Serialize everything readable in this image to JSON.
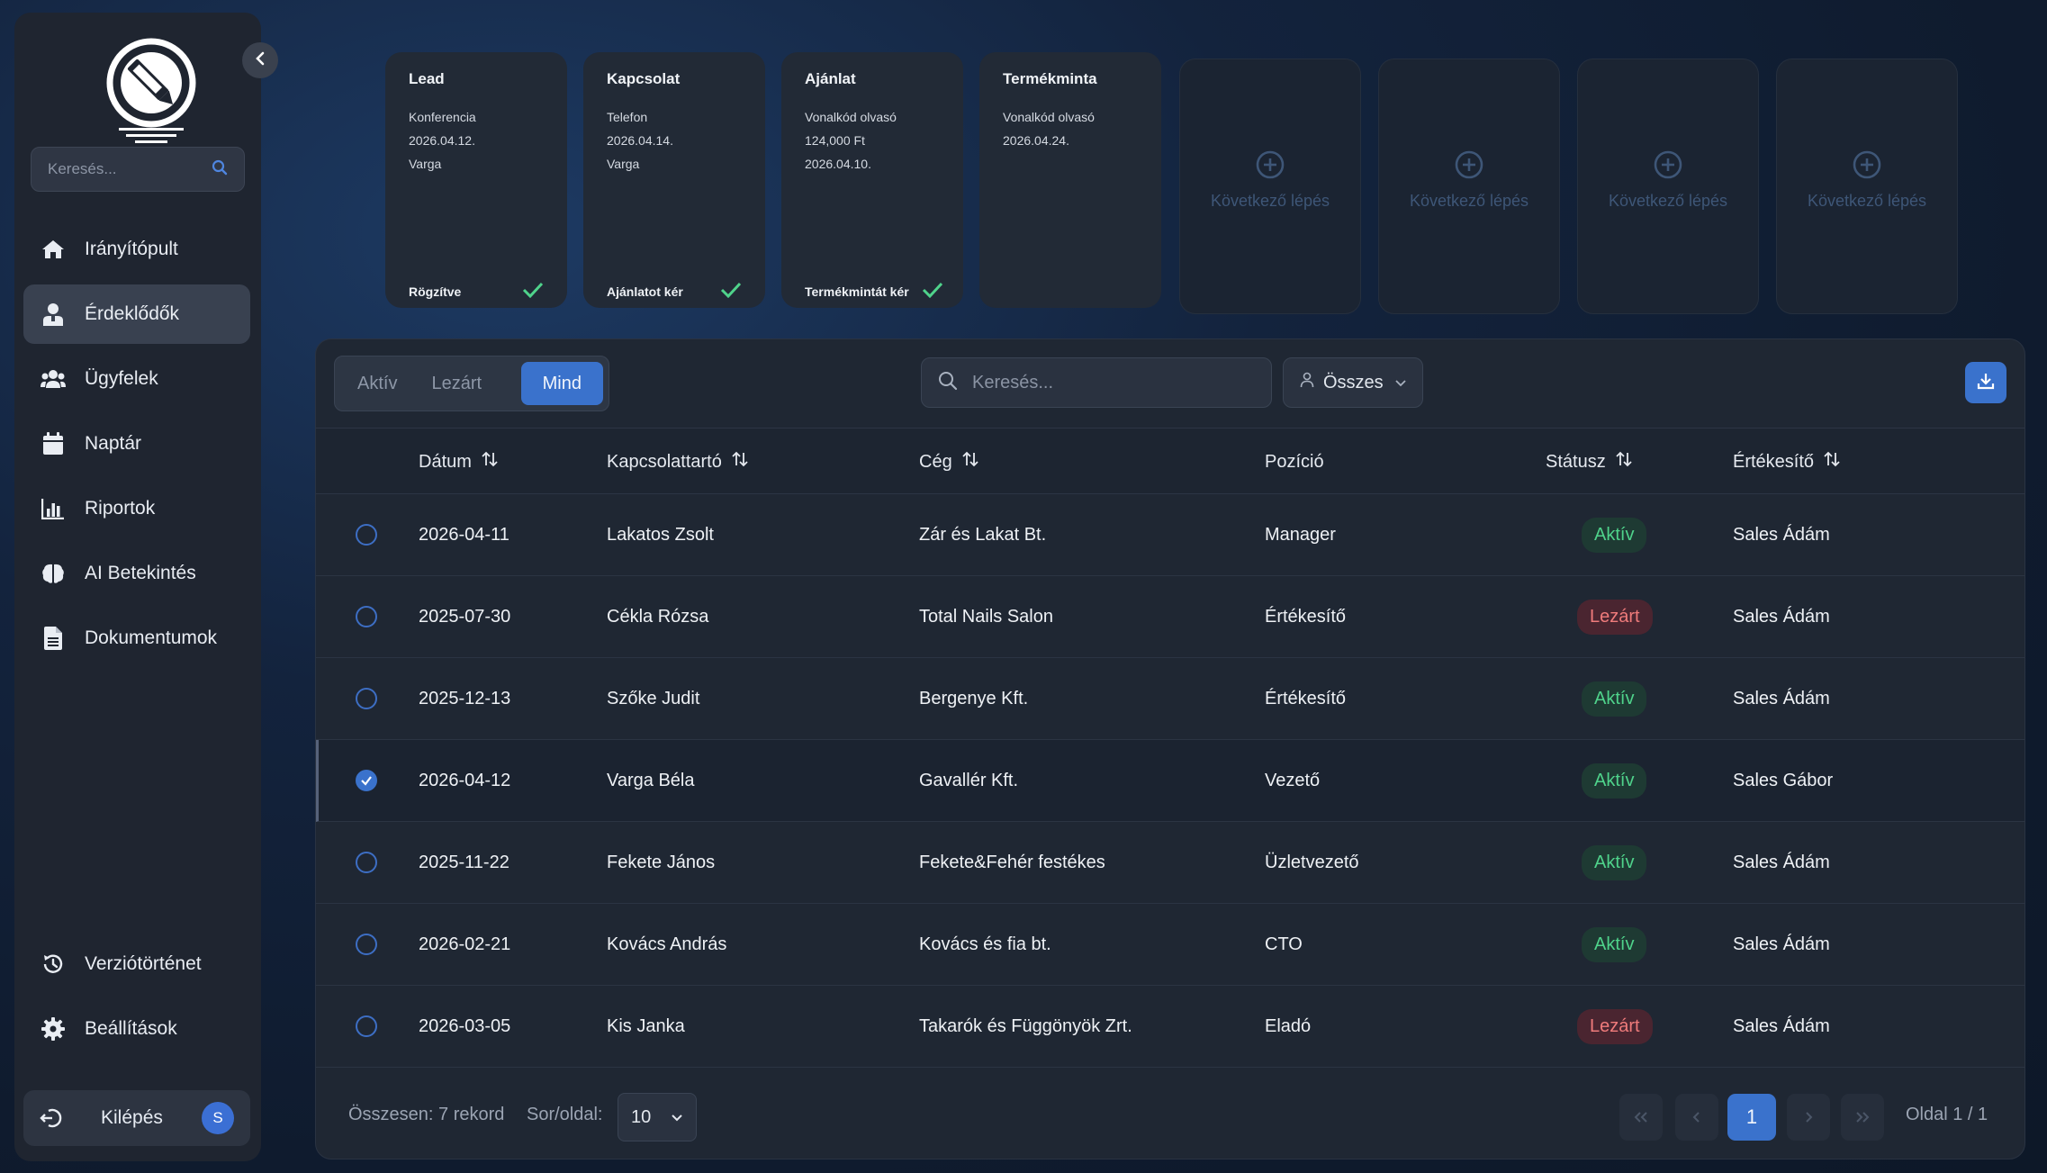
{
  "sidebar": {
    "search_placeholder": "Keresés...",
    "items": [
      {
        "label": "Irányítópult",
        "icon": "home-icon"
      },
      {
        "label": "Érdeklődők",
        "icon": "user-icon",
        "active": true
      },
      {
        "label": "Ügyfelek",
        "icon": "users-icon"
      },
      {
        "label": "Naptár",
        "icon": "calendar-icon"
      },
      {
        "label": "Riportok",
        "icon": "bar-chart-icon"
      },
      {
        "label": "AI Betekintés",
        "icon": "brain-icon"
      },
      {
        "label": "Dokumentumok",
        "icon": "document-icon"
      }
    ],
    "bottom_items": [
      {
        "label": "Verziótörténet",
        "icon": "history-icon"
      },
      {
        "label": "Beállítások",
        "icon": "gear-icon"
      }
    ],
    "logout_label": "Kilépés",
    "avatar_initial": "S"
  },
  "pipeline": {
    "stages": [
      {
        "title": "Lead",
        "lines": [
          "Konferencia",
          "2026.04.12.",
          "Varga"
        ],
        "status": "Rögzítve"
      },
      {
        "title": "Kapcsolat",
        "lines": [
          "Telefon",
          "2026.04.14.",
          "Varga"
        ],
        "status": "Ajánlatot kér"
      },
      {
        "title": "Ajánlat",
        "lines": [
          "Vonalkód olvasó",
          "124,000 Ft",
          "2026.04.10."
        ],
        "status": "Termékmintát kér"
      },
      {
        "title": "Termékminta",
        "lines": [
          "Vonalkód olvasó",
          "2026.04.24."
        ],
        "status": ""
      }
    ],
    "next_step_label": "Következő lépés"
  },
  "toolbar": {
    "tabs": [
      "Aktív",
      "Lezárt",
      "Mind"
    ],
    "active_tab": "Mind",
    "search_placeholder": "Keresés...",
    "filter_label": "Összes"
  },
  "table": {
    "columns": [
      "Dátum",
      "Kapcsolattartó",
      "Cég",
      "Pozíció",
      "Státusz",
      "Értékesítő"
    ],
    "rows": [
      {
        "date": "2026-04-11",
        "contact": "Lakatos Zsolt",
        "company": "Zár és Lakat Bt.",
        "position": "Manager",
        "status": "Aktív",
        "sales": "Sales Ádám",
        "selected": false
      },
      {
        "date": "2025-07-30",
        "contact": "Cékla Rózsa",
        "company": "Total Nails Salon",
        "position": "Értékesítő",
        "status": "Lezárt",
        "sales": "Sales Ádám",
        "selected": false
      },
      {
        "date": "2025-12-13",
        "contact": "Szőke Judit",
        "company": "Bergenye Kft.",
        "position": "Értékesítő",
        "status": "Aktív",
        "sales": "Sales Ádám",
        "selected": false
      },
      {
        "date": "2026-04-12",
        "contact": "Varga Béla",
        "company": "Gavallér Kft.",
        "position": "Vezető",
        "status": "Aktív",
        "sales": "Sales Gábor",
        "selected": true
      },
      {
        "date": "2025-11-22",
        "contact": "Fekete János",
        "company": "Fekete&Fehér festékes",
        "position": "Üzletvezető",
        "status": "Aktív",
        "sales": "Sales Ádám",
        "selected": false
      },
      {
        "date": "2026-02-21",
        "contact": "Kovács András",
        "company": "Kovács és fia bt.",
        "position": "CTO",
        "status": "Aktív",
        "sales": "Sales Ádám",
        "selected": false
      },
      {
        "date": "2026-03-05",
        "contact": "Kis Janka",
        "company": "Takarók és Függönyök Zrt.",
        "position": "Eladó",
        "status": "Lezárt",
        "sales": "Sales Ádám",
        "selected": false
      }
    ]
  },
  "footer": {
    "total": "Összesen: 7 rekord",
    "per_page_label": "Sor/oldal:",
    "per_page_value": "10",
    "current_page": "1",
    "page_info": "Oldal 1 / 1"
  },
  "colors": {
    "accent": "#3a72cc",
    "active_green": "#4fd38b",
    "closed_red": "#ef7b7b"
  }
}
